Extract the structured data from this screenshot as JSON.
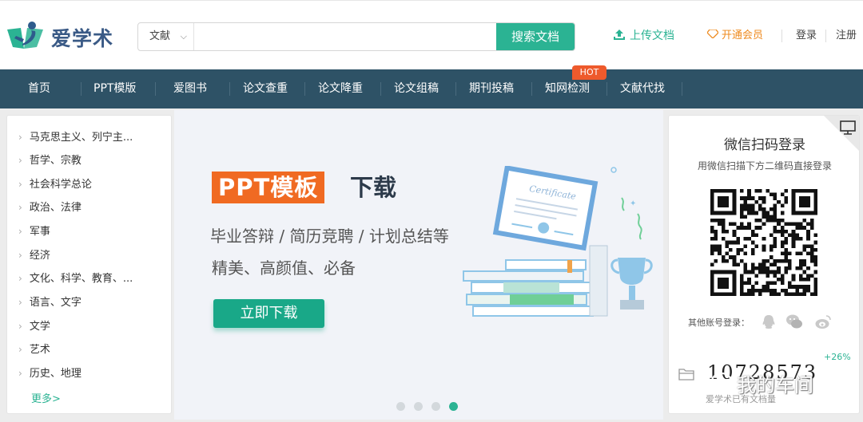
{
  "header": {
    "logo_text": "爱学术",
    "search": {
      "type_label": "文献",
      "placeholder": "",
      "button_label": "搜索文档"
    },
    "links": {
      "upload": "上传文档",
      "member": "开通会员",
      "login": "登录",
      "register": "注册"
    }
  },
  "nav": {
    "items": [
      {
        "label": "首页"
      },
      {
        "label": "PPT模版"
      },
      {
        "label": "爱图书"
      },
      {
        "label": "论文查重"
      },
      {
        "label": "论文降重"
      },
      {
        "label": "论文组稿"
      },
      {
        "label": "期刊投稿"
      },
      {
        "label": "知网检测"
      },
      {
        "label": "文献代找"
      }
    ],
    "hot_badge": "HOT"
  },
  "categories": {
    "items": [
      "马克思主义、列宁主...",
      "哲学、宗教",
      "社会科学总论",
      "政治、法律",
      "军事",
      "经济",
      "文化、科学、教育、...",
      "语言、文字",
      "文学",
      "艺术",
      "历史、地理"
    ],
    "more": "更多>"
  },
  "banner": {
    "tag": "PPT模板",
    "title": "下载",
    "subtitle1": "毕业答辩 / 简历竞聘 / 计划总结等",
    "subtitle2": "精美、高颜值、必备",
    "button": "立即下载",
    "certificate_text": "Certificate",
    "slide_count": 4,
    "active_slide": 4
  },
  "login_panel": {
    "title": "微信扫码登录",
    "subtitle": "用微信扫描下方二维码直接登录",
    "other_login": "其他账号登录：",
    "growth": "+26%",
    "doc_count": "10728573",
    "doc_label": "爱学术已有文档量"
  },
  "watermark": "我的车间",
  "colors": {
    "accent": "#2bb393",
    "nav_bg": "#2e5266",
    "hot": "#ee5a2c",
    "orange": "#f06a22"
  }
}
